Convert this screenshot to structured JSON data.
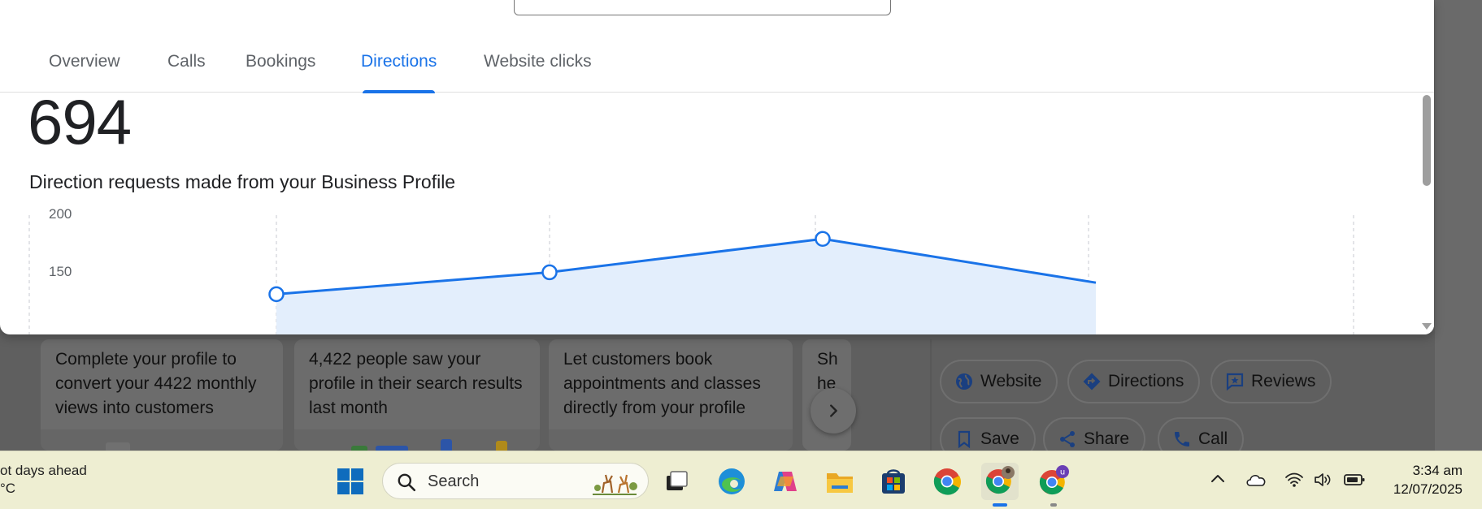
{
  "tabs": [
    {
      "label": "Overview",
      "active": false
    },
    {
      "label": "Calls",
      "active": false
    },
    {
      "label": "Bookings",
      "active": false
    },
    {
      "label": "Directions",
      "active": true
    },
    {
      "label": "Website clicks",
      "active": false
    }
  ],
  "metric": {
    "value": "694",
    "description": "Direction requests made from your Business Profile"
  },
  "chart_data": {
    "type": "area",
    "y_ticks": [
      "200",
      "150"
    ],
    "ylim_visible": [
      115,
      200
    ],
    "points": [
      {
        "x": 0,
        "y": 130
      },
      {
        "x": 1,
        "y": 149
      },
      {
        "x": 2,
        "y": 178
      },
      {
        "x": 3,
        "y": 140
      }
    ],
    "color": "#1a73e8",
    "fill": "#e3eefc",
    "grid": "vertical-dashed"
  },
  "promo_cards": [
    {
      "text": "Complete your profile to convert your 4422 monthly views into customers"
    },
    {
      "text": "4,422 people saw your profile in their search results last month"
    },
    {
      "text": "Let customers book appointments and classes directly from your profile"
    },
    {
      "text": "Sh he"
    }
  ],
  "actions": {
    "website": "Website",
    "directions": "Directions",
    "reviews": "Reviews",
    "save": "Save",
    "share": "Share",
    "call": "Call"
  },
  "taskbar": {
    "weather_line1": "ot days ahead",
    "weather_line2": "°C",
    "search_label": "Search",
    "time": "3:34 am",
    "date": "12/07/2025",
    "chrome_badge": "u"
  },
  "colors": {
    "accent": "#1a73e8",
    "taskbar": "#eeeed2",
    "overlay": "#5f5f5f"
  }
}
